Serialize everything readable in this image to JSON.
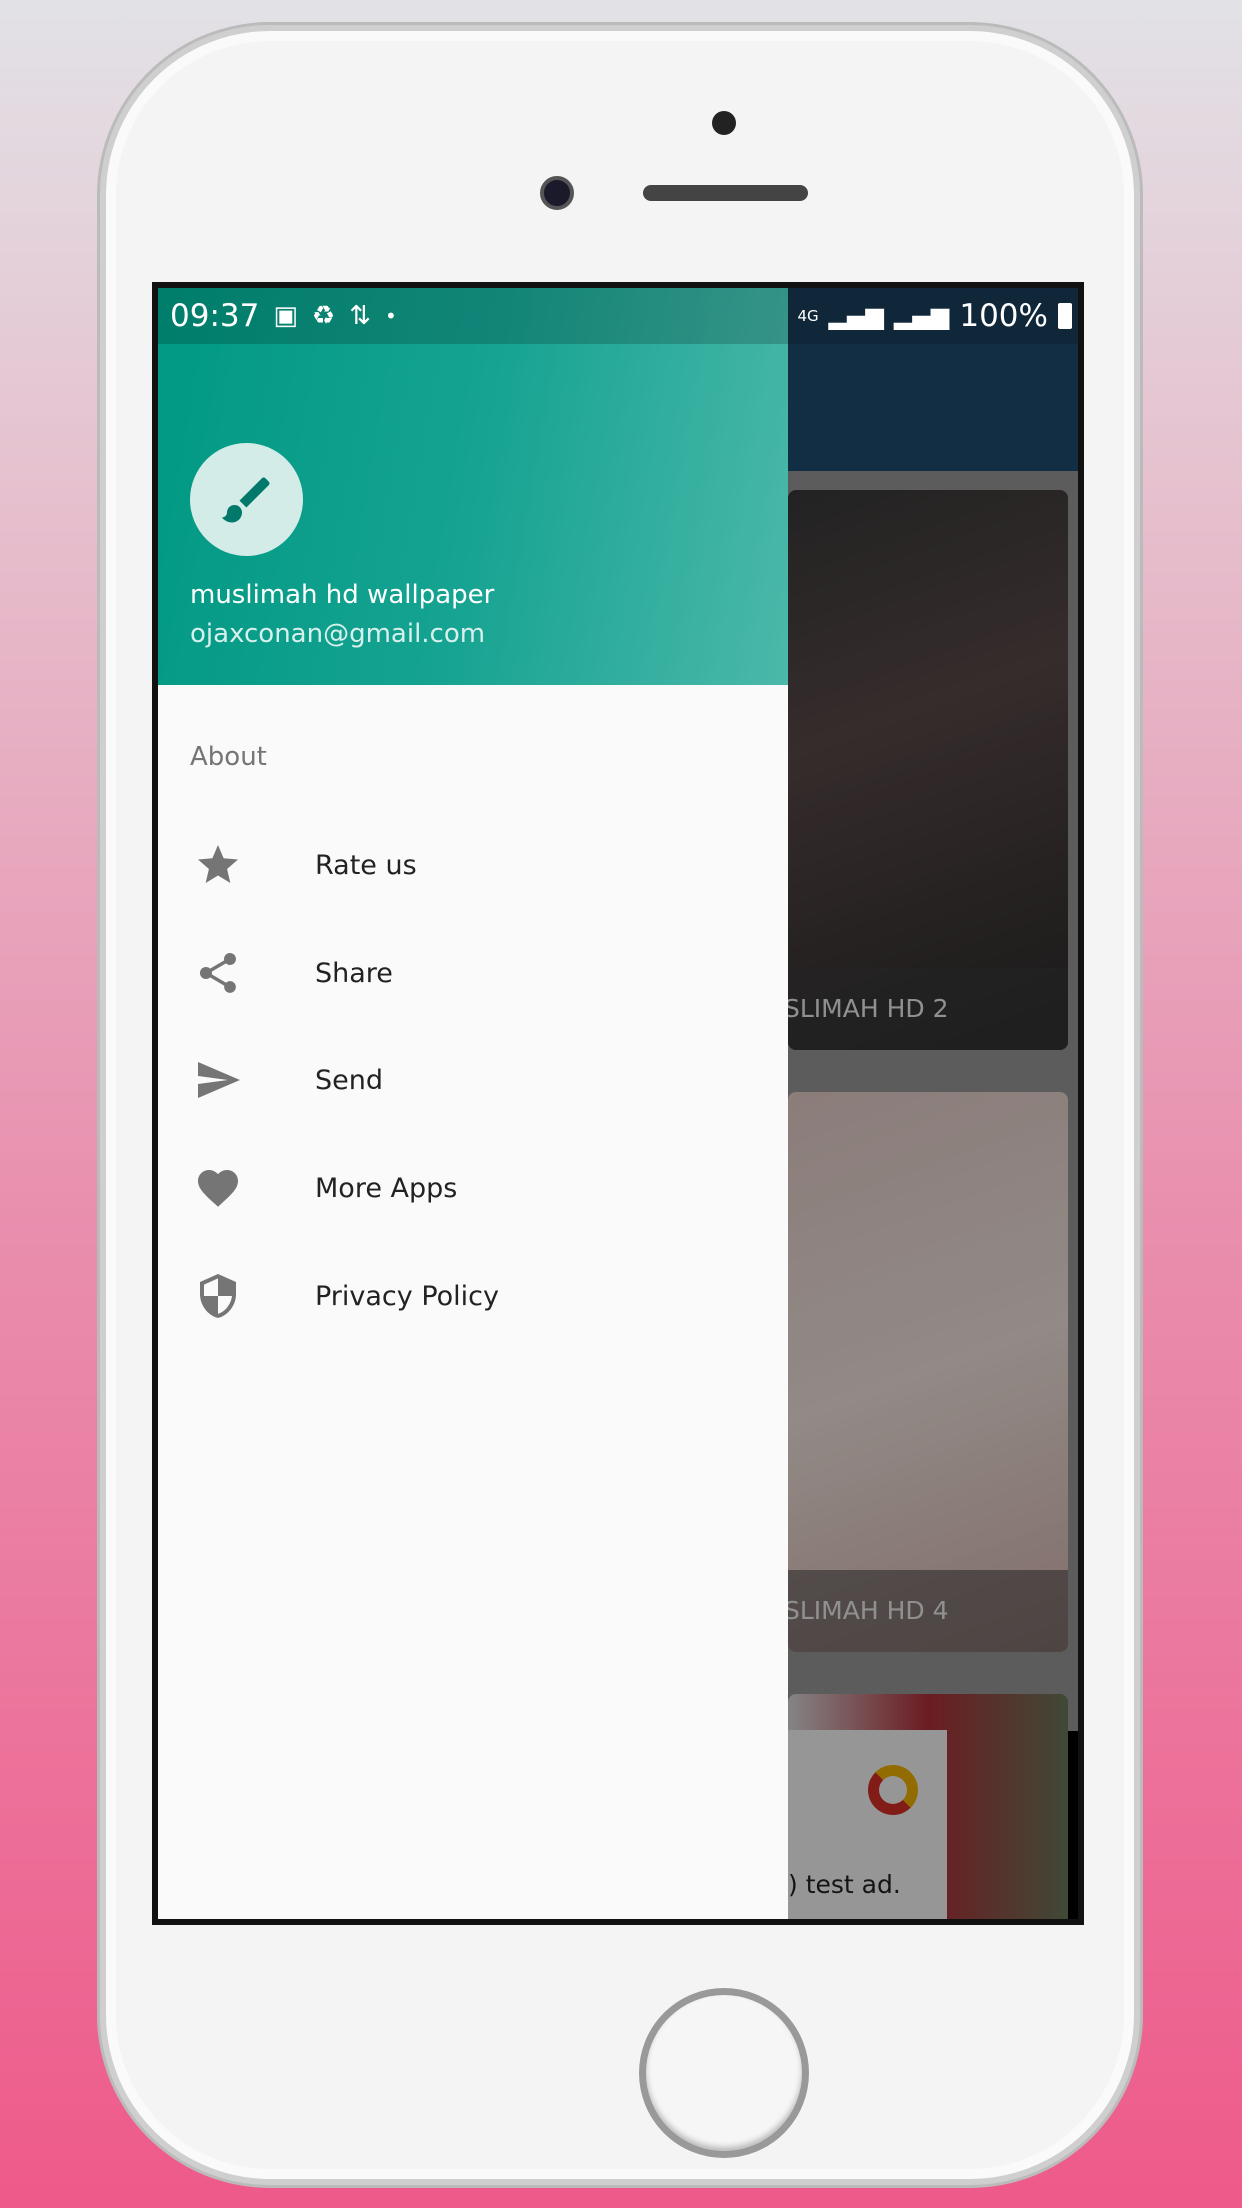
{
  "status_bar": {
    "time": "09:37",
    "network": "4G",
    "battery": "100%"
  },
  "drawer": {
    "header": {
      "app_name": "muslimah hd wallpaper",
      "email": "ojaxconan@gmail.com",
      "avatar_icon": "paintbrush-icon"
    },
    "section_title": "About",
    "items": [
      {
        "label": "Rate us",
        "icon": "star-icon"
      },
      {
        "label": "Share",
        "icon": "share-icon"
      },
      {
        "label": "Send",
        "icon": "send-icon"
      },
      {
        "label": "More Apps",
        "icon": "heart-icon"
      },
      {
        "label": "Privacy Policy",
        "icon": "shield-icon"
      }
    ]
  },
  "background": {
    "cards": [
      {
        "caption": "SLIMAH HD 2"
      },
      {
        "caption": "SLIMAH HD 4"
      }
    ],
    "ad": {
      "text": ") test ad."
    }
  },
  "colors": {
    "drawer_header": "#009983",
    "app_bar": "#1f4d72",
    "page_bg_bottom": "#ee5a8a"
  }
}
